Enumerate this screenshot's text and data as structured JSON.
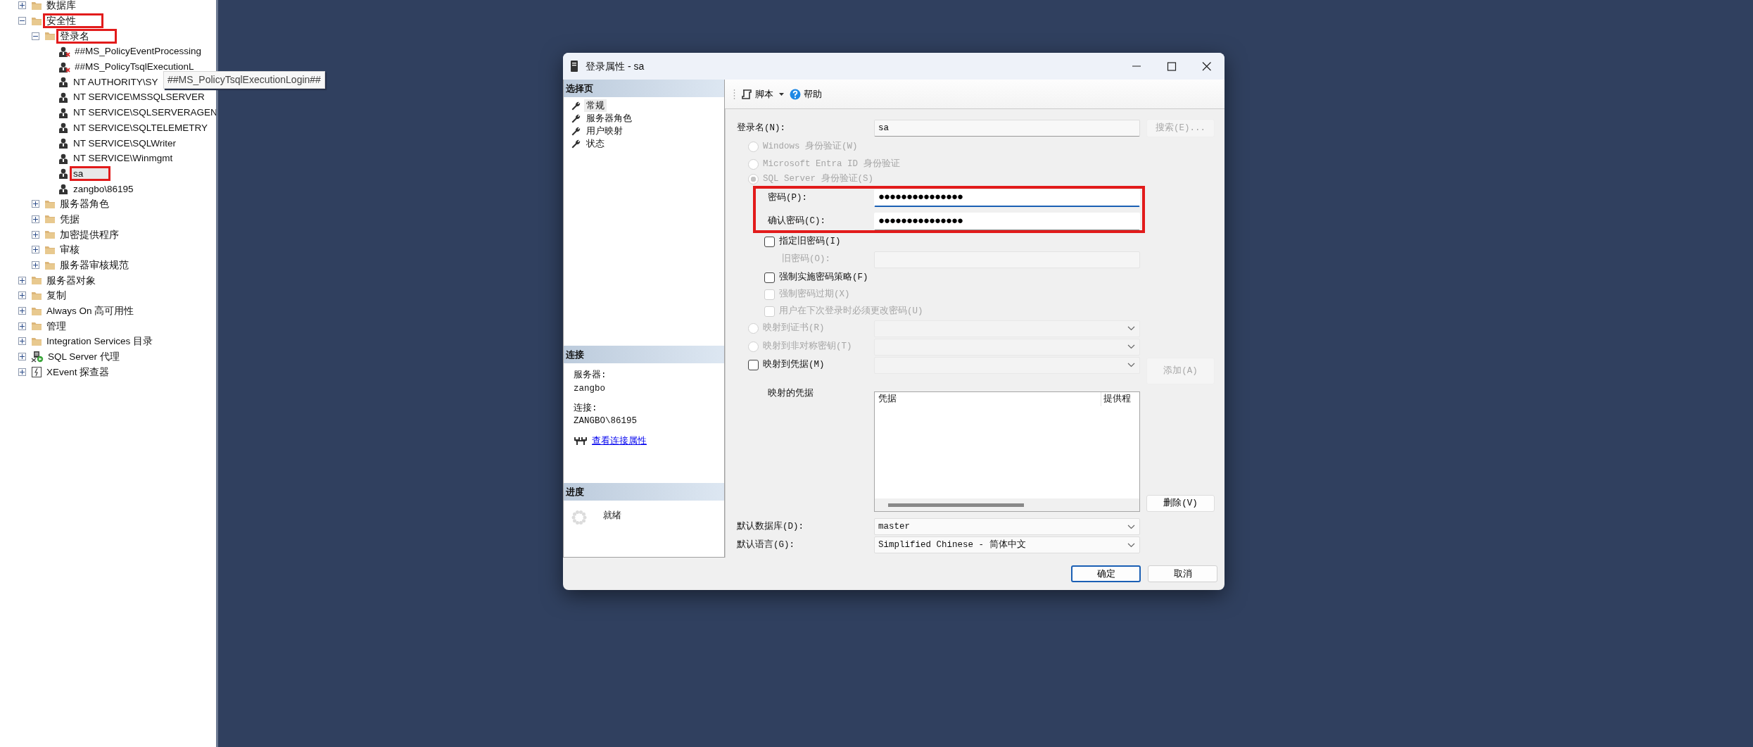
{
  "object_explorer": {
    "nodes": [
      {
        "label": "数据库",
        "kind": "folder",
        "expanded": false,
        "selected": false,
        "highlighted": false
      },
      {
        "label": "安全性",
        "kind": "folder",
        "expanded": true,
        "selected": false,
        "highlighted": true,
        "children": [
          {
            "label": "登录名",
            "kind": "folder",
            "expanded": true,
            "selected": false,
            "highlighted": true,
            "children": [
              {
                "label": "##MS_PolicyEventProcessing",
                "kind": "disabled_login",
                "selected": false,
                "highlighted": false
              },
              {
                "label": "##MS_PolicyTsqlExecutionL",
                "kind": "disabled_login",
                "selected": false,
                "highlighted": false
              },
              {
                "label": "NT AUTHORITY\\SY",
                "kind": "login",
                "selected": false,
                "highlighted": false
              },
              {
                "label": "NT SERVICE\\MSSQLSERVER",
                "kind": "login",
                "selected": false,
                "highlighted": false
              },
              {
                "label": "NT SERVICE\\SQLSERVERAGEN",
                "kind": "login",
                "selected": false,
                "highlighted": false
              },
              {
                "label": "NT SERVICE\\SQLTELEMETRY",
                "kind": "login",
                "selected": false,
                "highlighted": false
              },
              {
                "label": "NT SERVICE\\SQLWriter",
                "kind": "login",
                "selected": false,
                "highlighted": false
              },
              {
                "label": "NT SERVICE\\Winmgmt",
                "kind": "login",
                "selected": false,
                "highlighted": false
              },
              {
                "label": "sa",
                "kind": "login",
                "selected": true,
                "highlighted": true
              },
              {
                "label": "zangbo\\86195",
                "kind": "login",
                "selected": false,
                "highlighted": false
              }
            ]
          },
          {
            "label": "服务器角色",
            "kind": "folder",
            "expanded": false,
            "selected": false,
            "highlighted": false
          },
          {
            "label": "凭据",
            "kind": "folder",
            "expanded": false,
            "selected": false,
            "highlighted": false
          },
          {
            "label": "加密提供程序",
            "kind": "folder",
            "expanded": false,
            "selected": false,
            "highlighted": false
          },
          {
            "label": "审核",
            "kind": "folder",
            "expanded": false,
            "selected": false,
            "highlighted": false
          },
          {
            "label": "服务器审核规范",
            "kind": "folder",
            "expanded": false,
            "selected": false,
            "highlighted": false
          }
        ]
      },
      {
        "label": "服务器对象",
        "kind": "folder",
        "expanded": false,
        "selected": false,
        "highlighted": false
      },
      {
        "label": "复制",
        "kind": "folder",
        "expanded": false,
        "selected": false,
        "highlighted": false
      },
      {
        "label": "Always On 高可用性",
        "kind": "folder",
        "expanded": false,
        "selected": false,
        "highlighted": false
      },
      {
        "label": "管理",
        "kind": "folder",
        "expanded": false,
        "selected": false,
        "highlighted": false
      },
      {
        "label": "Integration Services 目录",
        "kind": "folder",
        "expanded": false,
        "selected": false,
        "highlighted": false
      },
      {
        "label": "SQL Server 代理",
        "kind": "agent",
        "expanded": false,
        "selected": false,
        "highlighted": false
      },
      {
        "label": "XEvent 探查器",
        "kind": "xevent",
        "expanded": false,
        "selected": false,
        "highlighted": false
      }
    ],
    "tooltip": {
      "text": "##MS_PolicyTsqlExecutionLogin##"
    }
  },
  "dialog": {
    "title": "登录属性 - sa",
    "sidebar": [
      {
        "kind": "pages",
        "title": "选择页",
        "pages": [
          {
            "label": "常规",
            "selected": true
          },
          {
            "label": "服务器角色",
            "selected": false
          },
          {
            "label": "用户映射",
            "selected": false
          },
          {
            "label": "状态",
            "selected": false
          }
        ]
      },
      {
        "kind": "connection",
        "title": "连接",
        "server_label": "服务器:",
        "server": "zangbo",
        "connection_label": "连接:",
        "connection": "ZANGBO\\86195",
        "link": "查看连接属性"
      },
      {
        "kind": "progress",
        "title": "进度",
        "status": "就绪"
      }
    ],
    "toolbar": [
      {
        "label": "脚本",
        "dropdown": true
      },
      {
        "label": "帮助",
        "dropdown": false
      }
    ],
    "form": {
      "login": {
        "label": "登录名(N):",
        "value": "sa"
      },
      "search_button": {
        "label": "搜索(E)...",
        "disabled": true
      },
      "auth_modes": [
        {
          "label": "Windows 身份验证(W)",
          "selected": false,
          "disabled": true
        },
        {
          "label": "Microsoft Entra ID 身份验证",
          "selected": false,
          "disabled": true
        },
        {
          "label": "SQL Server 身份验证(S)",
          "selected": true,
          "disabled": true
        }
      ],
      "password_fields": {
        "highlighted": true,
        "fields": [
          {
            "label": "密码(P):",
            "value": "●●●●●●●●●●●●●●●",
            "focused": true
          },
          {
            "label": "确认密码(C):",
            "value": "●●●●●●●●●●●●●●●",
            "focused": false
          }
        ]
      },
      "old_password_check": {
        "label": "指定旧密码(I)",
        "checked": false,
        "disabled": false
      },
      "old_password": {
        "label": "旧密码(O):",
        "disabled": true
      },
      "policy_options": [
        {
          "label": "强制实施密码策略(F)",
          "checked": false,
          "disabled": false
        },
        {
          "label": "强制密码过期(X)",
          "checked": false,
          "disabled": true
        },
        {
          "label": "用户在下次登录时必须更改密码(U)",
          "checked": false,
          "disabled": true
        }
      ],
      "mappings": [
        {
          "kind": "radio",
          "label": "映射到证书(R)",
          "selected": false,
          "disabled": true
        },
        {
          "kind": "radio",
          "label": "映射到非对称密钥(T)",
          "selected": false,
          "disabled": true
        },
        {
          "kind": "checkbox",
          "label": "映射到凭据(M)",
          "checked": false,
          "disabled": false
        }
      ],
      "add_button": {
        "label": "添加(A)",
        "disabled": true
      },
      "mapped_credentials": {
        "label": "映射的凭据",
        "columns": [
          "凭据",
          "提供程"
        ]
      },
      "delete_button": {
        "label": "删除(V)",
        "disabled": false
      },
      "defaults": [
        {
          "label": "默认数据库(D):",
          "value": "master"
        },
        {
          "label": "默认语言(G):",
          "value": "Simplified Chinese - 简体中文"
        }
      ]
    },
    "buttons": [
      {
        "label": "确定",
        "default": true
      },
      {
        "label": "取消",
        "default": false
      }
    ]
  }
}
